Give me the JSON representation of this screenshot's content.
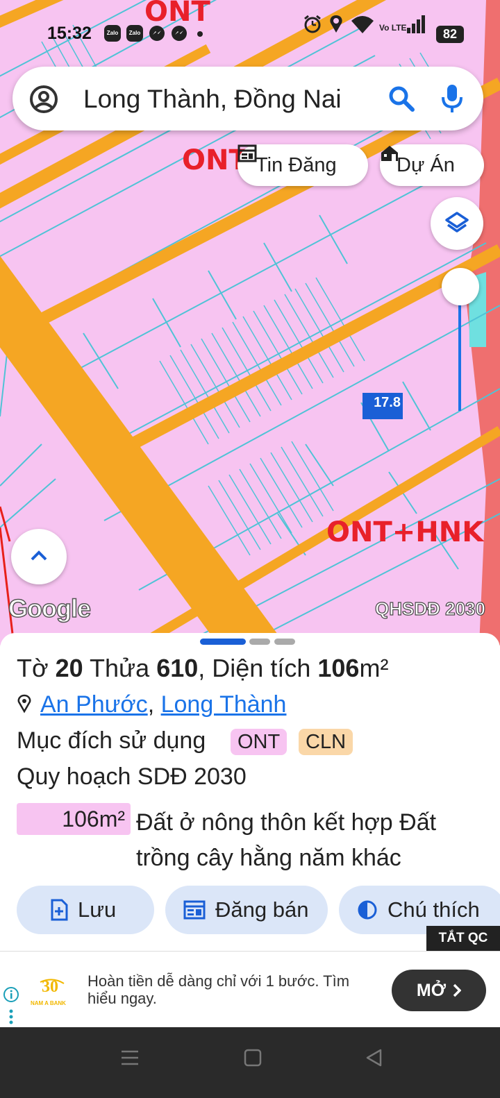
{
  "status_bar": {
    "time": "15:32",
    "apps": [
      "Zalo",
      "Zalo",
      "Messenger",
      "Messenger"
    ],
    "network": "Vo LTE",
    "battery": "82"
  },
  "search": {
    "query": "Long Thành, Đồng Nai"
  },
  "chips": {
    "listings": "Tin Đăng",
    "projects": "Dự Án"
  },
  "map": {
    "zone_labels": [
      "ONT",
      "ONT",
      "ONT+HNK"
    ],
    "parcel_label": "17.8",
    "google": "Google",
    "layer_tag": "QHSDĐ 2030"
  },
  "parcel": {
    "sheet_label": "Tờ",
    "sheet_number": "20",
    "plot_label": "Thửa",
    "plot_number": "610",
    "area_label": "Diện tích",
    "area_value": "106",
    "area_unit": "m²",
    "ward": "An Phước",
    "district": "Long Thành",
    "purpose_label": "Mục đích sử dụng",
    "purpose_badges": [
      "ONT",
      "CLN"
    ],
    "plan_label": "Quy hoạch SDĐ 2030",
    "plan_area": "106m²",
    "plan_description": "Đất ở nông thôn kết hợp Đất trồng cây hằng năm khác"
  },
  "actions": {
    "save": "Lưu",
    "post_sale": "Đăng bán",
    "legend": "Chú thích"
  },
  "ad": {
    "close_label": "TẮT QC",
    "brand": "NAM A BANK",
    "text": "Hoàn tiền dễ dàng chỉ với 1 bước. Tìm hiểu ngay.",
    "cta": "MỞ"
  },
  "colors": {
    "map_pink": "#f7c4f1",
    "road_orange": "#f5a623",
    "parcel_line": "#4fc3d6",
    "zone_red": "#e8202a",
    "accent_blue": "#1a73e8",
    "badge_ont": "#f7c4f1",
    "badge_cln": "#fad7a8"
  }
}
